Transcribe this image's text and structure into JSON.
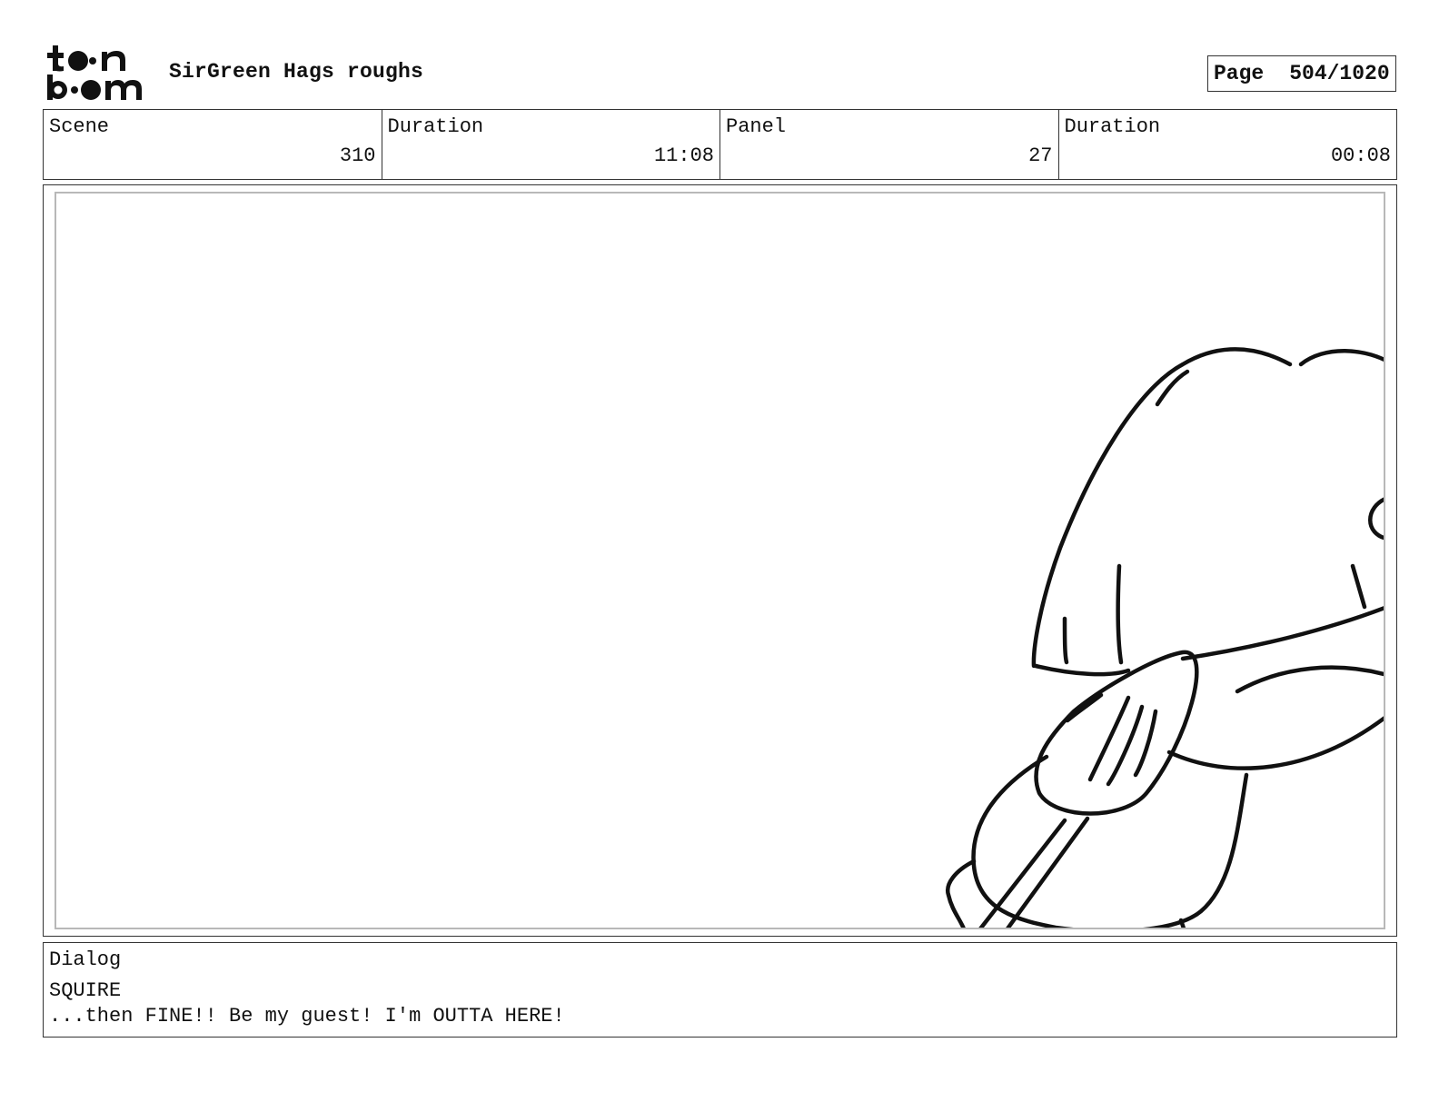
{
  "header": {
    "logo_text": "toon boom",
    "project_title": "SirGreen Hags roughs",
    "page_label": "Page",
    "page_number": "504/1020"
  },
  "info": {
    "scene_label": "Scene",
    "scene_value": "310",
    "scene_duration_label": "Duration",
    "scene_duration_value": "11:08",
    "panel_label": "Panel",
    "panel_value": "27",
    "panel_duration_label": "Duration",
    "panel_duration_value": "00:08"
  },
  "panel": {
    "drawing": "rough-sketch-icon"
  },
  "dialog": {
    "label": "Dialog",
    "speaker": "SQUIRE",
    "line": "...then FINE!! Be my guest! I'm OUTTA HERE!"
  }
}
